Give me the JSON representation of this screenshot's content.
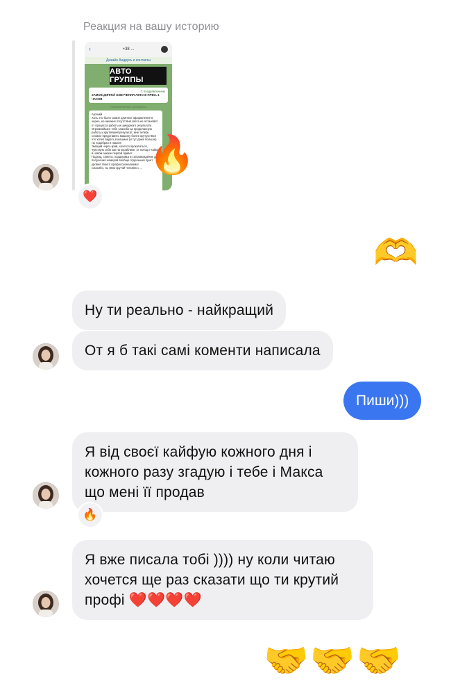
{
  "story": {
    "caption": "Реакция на вашу историю",
    "thumb_top": "+38 ...",
    "thumb_sub": "Дизайн Андрусь и контакты",
    "banner": "АВТО ГРУППЫ",
    "card_line1": "С поздравлением",
    "card_line2": "ЗАМОВ ДИННОЇ ОЗВУЧЕНИЯ АВТО В НРВО. 4 ЧАСОВ",
    "date_label": "Непрочитанные сообщения",
    "message_text": "Артемій\nХоть это было самое длинное оформление в черно, но никаких отсутствия света не остановят от процесса работы и шикарного результата\nОгромнейшее тебе спасибо за проделанную работу и крутейший результат, мне теперь сложно представить машину более крутую! Все что хотел видеть в машине (и тут даже больше) ты подобрал и нашел!\nЭмоций через край, хочется прокатиться, чувствую себя как на кораблике, от поезд к чайке в новом заказе первой привет\nПодход, советы, поддержка и сопровождение до получения номеров вообще отдельный пункт уровня твоего профессионализма!\nСпасибо, ты явно крутой человек с ...",
    "fire_emoji": "🔥",
    "reaction": "❤️"
  },
  "messages": {
    "out_hands_heart": "🫶",
    "in1": "Ну ти реально - найкращий",
    "in2": "От я б такі самі коменти написала",
    "out1": "Пиши)))",
    "in3": "Я від своєї кайфую кожного дня і кожного разу згадую і тебе і Макса що мені її продав",
    "in3_reaction": "🔥",
    "in4": "Я вже писала тобі )))) ну коли читаю хочется ще раз сказати що ти крутий профі ❤️❤️❤️❤️",
    "out_handshakes": "🤝🤝🤝"
  },
  "colors": {
    "bubble_in": "#efeff1",
    "bubble_out": "#3a76f0",
    "caption": "#8e8e93"
  }
}
